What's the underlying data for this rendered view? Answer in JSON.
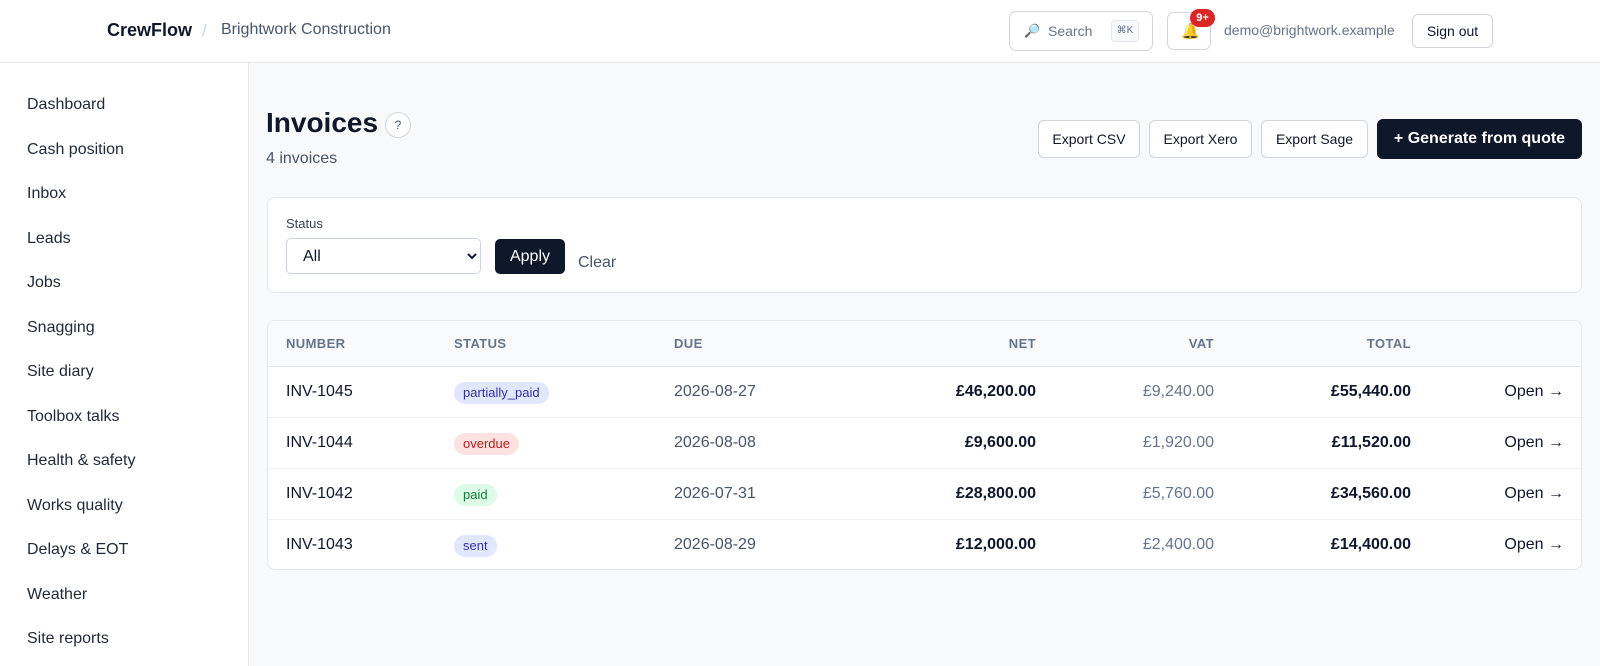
{
  "header": {
    "brand": "CrewFlow",
    "separator": "/",
    "organization": "Brightwork Construction",
    "search_label": "Search",
    "search_shortcut": "⌘K",
    "notification_badge": "9+",
    "user_email": "demo@brightwork.example",
    "sign_out_label": "Sign out"
  },
  "sidebar": {
    "items": [
      {
        "label": "Dashboard"
      },
      {
        "label": "Cash position"
      },
      {
        "label": "Inbox"
      },
      {
        "label": "Leads"
      },
      {
        "label": "Jobs"
      },
      {
        "label": "Snagging"
      },
      {
        "label": "Site diary"
      },
      {
        "label": "Toolbox talks"
      },
      {
        "label": "Health & safety"
      },
      {
        "label": "Works quality"
      },
      {
        "label": "Delays & EOT"
      },
      {
        "label": "Weather"
      },
      {
        "label": "Site reports"
      }
    ]
  },
  "page": {
    "title": "Invoices",
    "help_label": "?",
    "count_label": "4 invoices",
    "actions": {
      "export_csv": "Export CSV",
      "export_xero": "Export Xero",
      "export_sage": "Export Sage",
      "generate": "+ Generate from quote"
    }
  },
  "filter": {
    "status_label": "Status",
    "status_selected": "All",
    "apply_label": "Apply",
    "clear_label": "Clear"
  },
  "table": {
    "headers": {
      "number": "NUMBER",
      "status": "STATUS",
      "due": "DUE",
      "net": "NET",
      "vat": "VAT",
      "total": "TOTAL"
    },
    "rows": [
      {
        "number": "INV-1045",
        "status": "partially_paid",
        "due": "2026-08-27",
        "net": "£46,200.00",
        "vat": "£9,240.00",
        "total": "£55,440.00",
        "action": "Open →"
      },
      {
        "number": "INV-1044",
        "status": "overdue",
        "due": "2026-08-08",
        "net": "£9,600.00",
        "vat": "£1,920.00",
        "total": "£11,520.00",
        "action": "Open →"
      },
      {
        "number": "INV-1042",
        "status": "paid",
        "due": "2026-07-31",
        "net": "£28,800.00",
        "vat": "£5,760.00",
        "total": "£34,560.00",
        "action": "Open →"
      },
      {
        "number": "INV-1043",
        "status": "sent",
        "due": "2026-08-29",
        "net": "£12,000.00",
        "vat": "£2,400.00",
        "total": "£14,400.00",
        "action": "Open →"
      }
    ]
  },
  "colors": {
    "primary": "#0f172a",
    "badge_red": "#dc2626",
    "status_partially_paid_bg": "#e0e7ff",
    "status_partially_paid_fg": "#3730a3",
    "status_overdue_bg": "#fee2e2",
    "status_overdue_fg": "#b91c1c",
    "status_paid_bg": "#dcfce7",
    "status_paid_fg": "#15803d",
    "status_sent_bg": "#e0e7ff",
    "status_sent_fg": "#3730a3"
  },
  "icons": {
    "search": "search-icon",
    "bell": "bell-icon"
  }
}
